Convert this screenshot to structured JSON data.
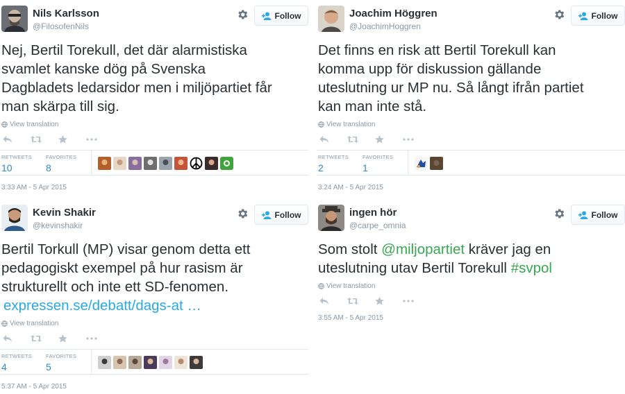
{
  "follow_label": "Follow",
  "view_translation_label": "View translation",
  "retweets_label": "RETWEETS",
  "favorites_label": "FAVORITES",
  "colors": {
    "link": "#2aa9e0",
    "hashtag_mention": "#38a850",
    "muted": "#8899a6",
    "stat_value": "#2a8ad0"
  },
  "icons": [
    "gear-icon",
    "add-user-icon",
    "globe-icon",
    "reply-icon",
    "retweet-icon",
    "favorite-icon",
    "more-icon"
  ],
  "tweets": [
    {
      "name": "Nils Karlsson",
      "handle": "@FilosofenNils",
      "lines": [
        "Nej, Bertil Torekull, det där alarmistiska",
        "svamlet kanske dög på Svenska",
        "Dagbladets ledarsidor men i miljöpartiet får",
        "man skärpa till sig."
      ],
      "retweets": "10",
      "favorites": "8",
      "timestamp": "3:33 AM - 5 Apr 2015"
    },
    {
      "name": "Joachim Höggren",
      "handle": "@JoachimHoggren",
      "lines": [
        "Det finns en risk att Bertil Torekull kan",
        "komma upp för diskussion gällande",
        "uteslutning ur MP nu. Så långt ifrån partiet",
        "kan man inte stå."
      ],
      "retweets": "2",
      "favorites": "1",
      "timestamp": "3:24 AM - 5 Apr 2015"
    },
    {
      "name": "Kevin Shakir",
      "handle": "@kevinshakir",
      "lines": [
        "Bertil Torkull (MP) visar genom detta ett",
        "pedagogiskt exempel på hur rasism är",
        "strukturellt och inte ett SD-fenomen."
      ],
      "link": "expressen.se/debatt/dags-at …",
      "retweets": "4",
      "favorites": "5",
      "timestamp": "5:37 AM - 5 Apr 2015"
    },
    {
      "name": "ingen hör",
      "handle": "@carpe_omnia",
      "line1_prefix": "Som stolt ",
      "line1_mention": "@miljopartiet",
      "line1_suffix": " kräver jag en",
      "line2_prefix": "uteslutning utav Bertil Torekull ",
      "line2_hashtag": "#svpol",
      "timestamp": "3:55 AM - 5 Apr 2015"
    }
  ]
}
